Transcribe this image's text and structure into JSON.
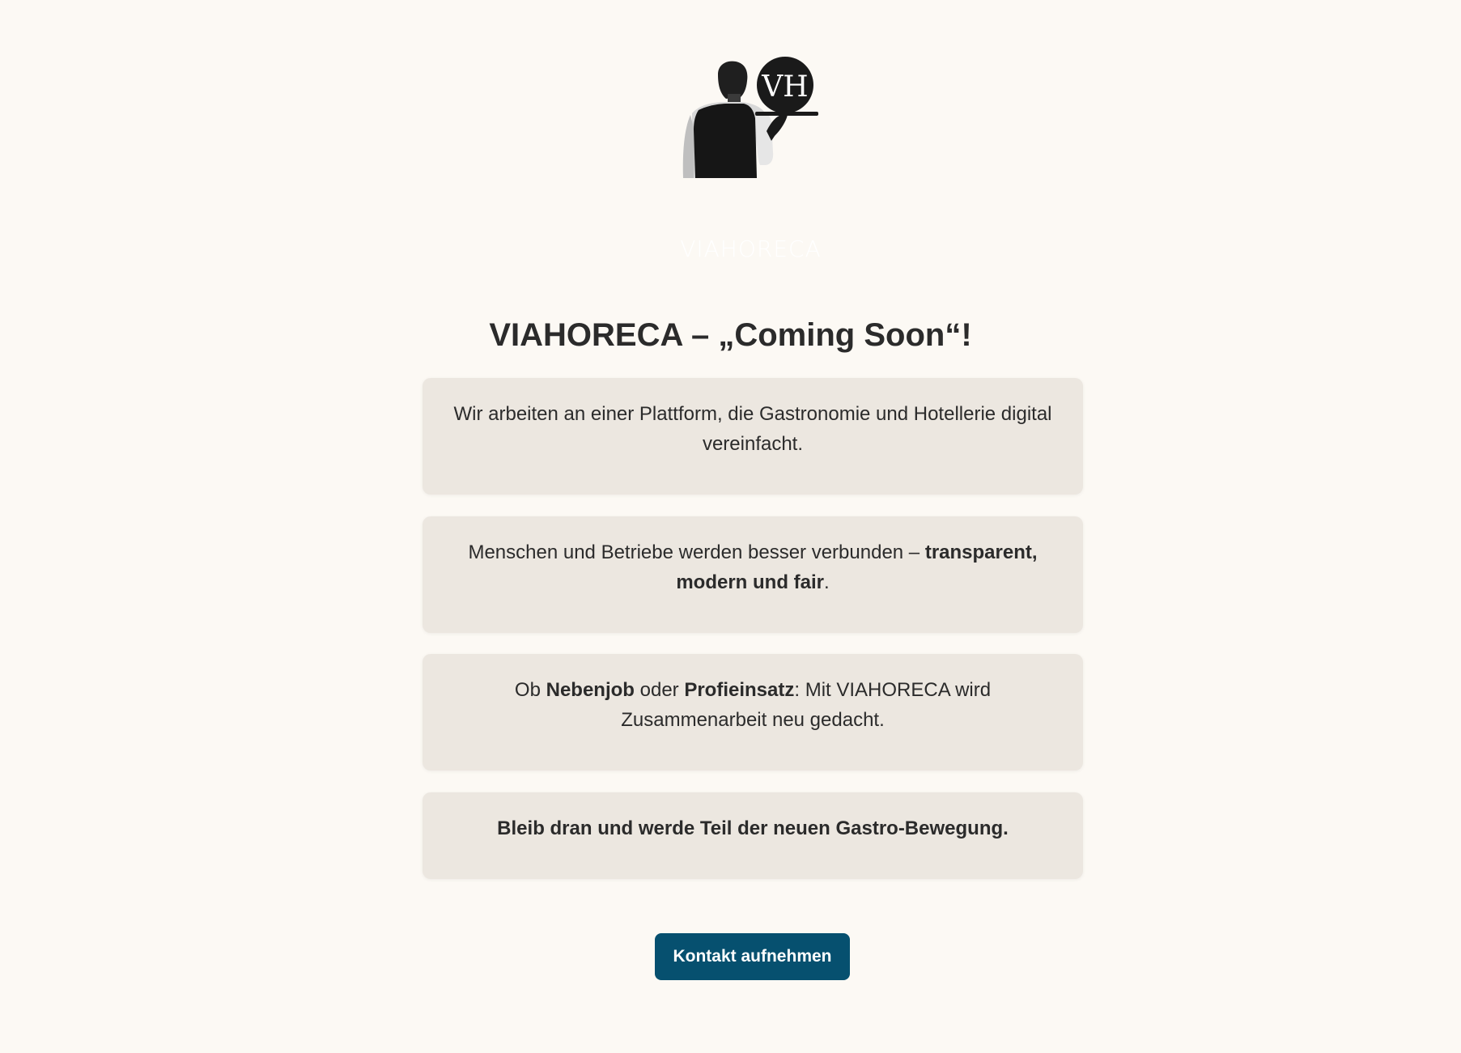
{
  "logo": {
    "monogram": "VH",
    "wordmark": "VIAHORECA",
    "icon": "waiter-with-tray-logo"
  },
  "title": "VIAHORECA – „Coming Soon“!",
  "cards": [
    {
      "parts": [
        {
          "text": "Wir arbeiten an einer Plattform, die Gastronomie und Hotellerie digital vereinfacht.",
          "bold": false
        }
      ]
    },
    {
      "parts": [
        {
          "text": "Menschen und Betriebe werden besser verbunden – ",
          "bold": false
        },
        {
          "text": "transparent, modern und fair",
          "bold": true
        },
        {
          "text": ".",
          "bold": false
        }
      ]
    },
    {
      "parts": [
        {
          "text": "Ob ",
          "bold": false
        },
        {
          "text": "Nebenjob",
          "bold": true
        },
        {
          "text": " oder ",
          "bold": false
        },
        {
          "text": "Profieinsatz",
          "bold": true
        },
        {
          "text": ": Mit VIAHORECA wird Zusammenarbeit neu gedacht.",
          "bold": false
        }
      ]
    },
    {
      "parts": [
        {
          "text": "Bleib dran und werde Teil der neuen Gastro-Bewegung.",
          "bold": true
        }
      ]
    }
  ],
  "cta": {
    "label": "Kontakt aufnehmen"
  },
  "colors": {
    "background": "#fcf9f4",
    "card": "#ece7e0",
    "text": "#2b2b2b",
    "button": "#06506f",
    "button_text": "#ffffff"
  }
}
